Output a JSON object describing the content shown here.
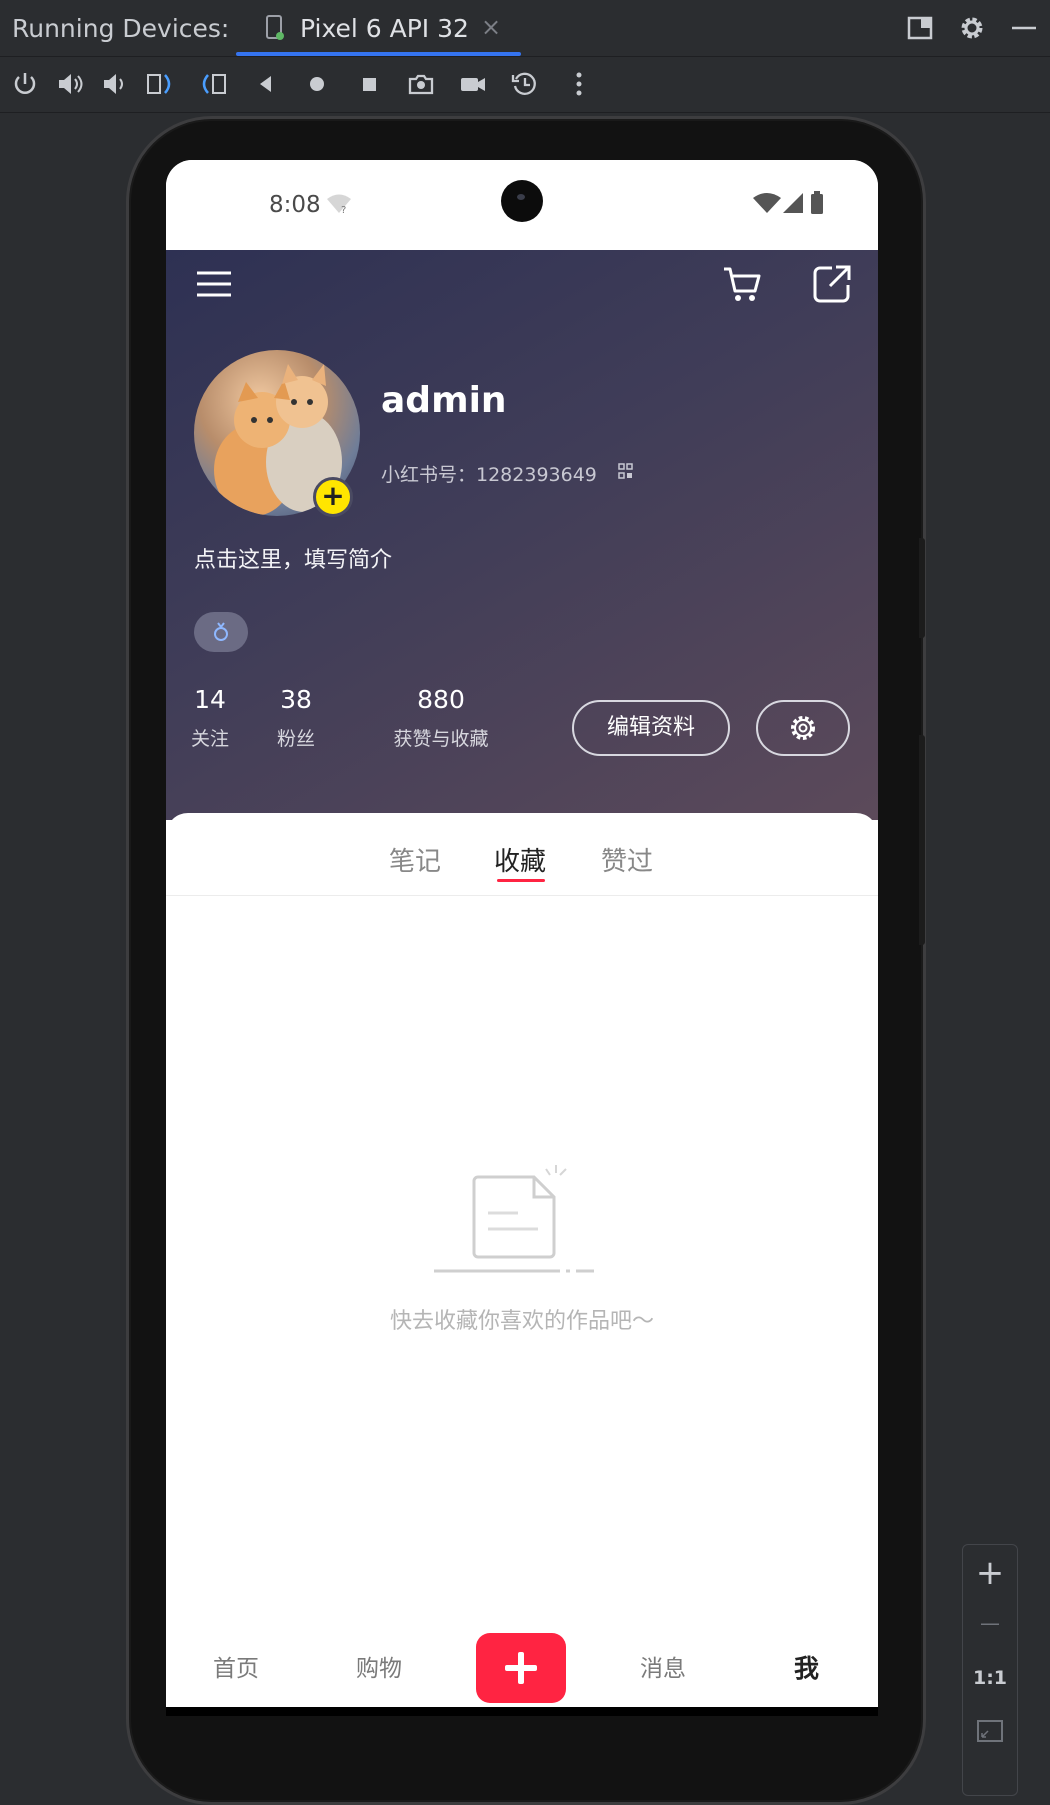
{
  "ide": {
    "panel_title": "Running Devices:",
    "device_tab": "Pixel 6 API 32",
    "close_glyph": "×",
    "toolbar_icons": [
      "power-icon",
      "volume-up-icon",
      "volume-down-icon",
      "rotate-left-icon",
      "rotate-right-icon",
      "back-icon",
      "home-icon",
      "overview-icon",
      "screenshot-icon",
      "screen-record-icon",
      "snapshot-icon",
      "more-icon"
    ],
    "accent": "#3574f0"
  },
  "phone": {
    "status": {
      "time": "8:08"
    },
    "header": {
      "username": "admin",
      "user_id": "小红书号：1282393649",
      "bio_placeholder": "点击这里，填写简介",
      "stats": [
        {
          "value": "14",
          "label": "关注"
        },
        {
          "value": "38",
          "label": "粉丝"
        },
        {
          "value": "880",
          "label": "获赞与收藏"
        }
      ],
      "edit_profile_label": "编辑资料"
    },
    "tabs": [
      {
        "label": "笔记",
        "active": false
      },
      {
        "label": "收藏",
        "active": true
      },
      {
        "label": "赞过",
        "active": false
      }
    ],
    "empty_text": "快去收藏你喜欢的作品吧～",
    "bottom_nav": [
      {
        "label": "首页",
        "active": false
      },
      {
        "label": "购物",
        "active": false
      },
      {
        "label": "消息",
        "active": false
      },
      {
        "label": "我",
        "active": true
      }
    ],
    "brand_color": "#ff2442"
  },
  "zoom": {
    "plus": "+",
    "minus": "—",
    "one_to_one": "1:1"
  }
}
